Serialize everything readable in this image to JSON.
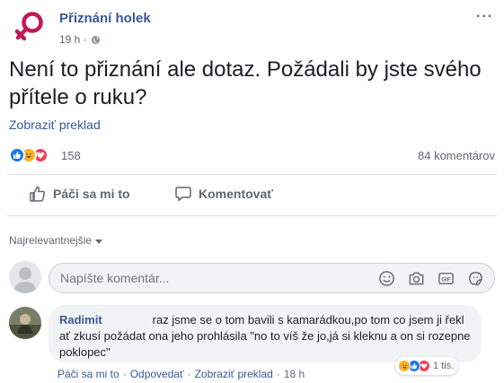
{
  "post": {
    "page_name": "Přiznání holek",
    "time": "19 h ·",
    "more": "···",
    "text": "Není to přiznání ale dotaz. Požádali by jste svého přítele o ruku?",
    "translate": "Zobraziť preklad"
  },
  "stats": {
    "reaction_count": "158",
    "comment_count": "84 komentárov"
  },
  "actions": {
    "like": "Páči sa mi to",
    "comment": "Komentovať"
  },
  "sort": {
    "label": "Najrelevantnejšie"
  },
  "composer": {
    "placeholder": "Napíšte komentár..."
  },
  "comment": {
    "author": "Radimit",
    "text": "raz jsme se o tom bavili s kamarádkou,po tom co jsem ji řekl ať zkusí požádat ona jeho prohlásila \"no to víš že jo,já si kleknu a on si rozepne poklopec\"",
    "reaction_count": "1 tis.",
    "like": "Páči sa mi to",
    "reply": "Odpovedať",
    "translate": "Zobraziť preklad",
    "time": "18 h",
    "sep": "·"
  },
  "colors": {
    "link": "#385898",
    "like_blue": "#1877f2",
    "haha_yellow": "#f7b125",
    "love_red": "#f33e58",
    "page_logo": "#c2185b"
  },
  "icons": {
    "page_avatar": "female-symbol-icon",
    "globe": "globe-icon",
    "like": "thumbs-up-icon",
    "comment": "speech-bubble-icon",
    "emoji": "smiley-icon",
    "camera": "camera-icon",
    "gif": "gif-icon",
    "sticker": "sticker-icon"
  }
}
